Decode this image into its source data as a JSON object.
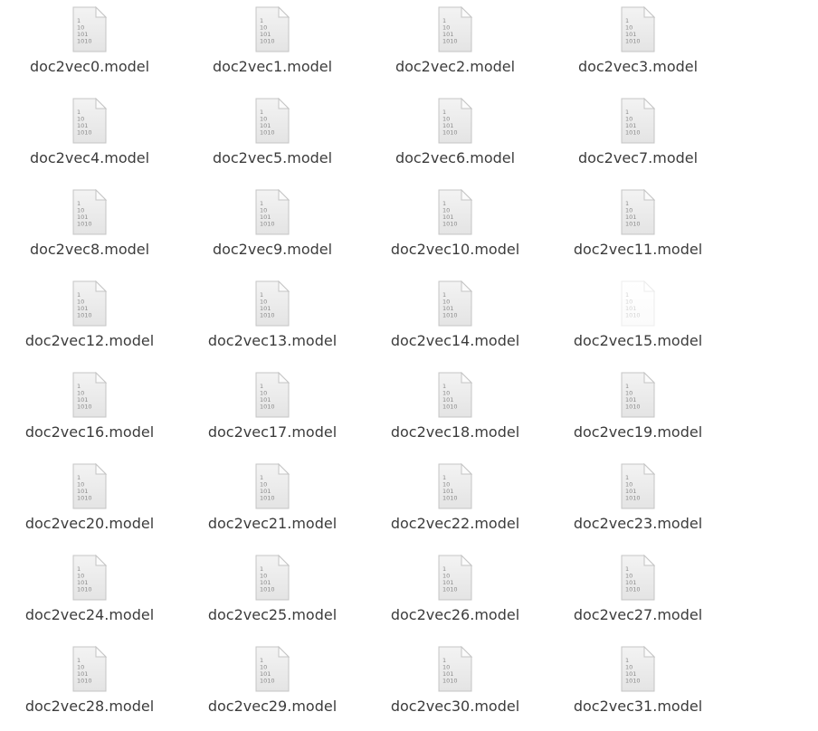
{
  "file_manager": {
    "view": "icon-grid",
    "columns": 4,
    "rows": 8,
    "files": [
      {
        "name": "doc2vec0.model",
        "icon": "binary-file-icon"
      },
      {
        "name": "doc2vec1.model",
        "icon": "binary-file-icon"
      },
      {
        "name": "doc2vec2.model",
        "icon": "binary-file-icon"
      },
      {
        "name": "doc2vec3.model",
        "icon": "binary-file-icon"
      },
      {
        "name": "doc2vec4.model",
        "icon": "binary-file-icon"
      },
      {
        "name": "doc2vec5.model",
        "icon": "binary-file-icon"
      },
      {
        "name": "doc2vec6.model",
        "icon": "binary-file-icon"
      },
      {
        "name": "doc2vec7.model",
        "icon": "binary-file-icon"
      },
      {
        "name": "doc2vec8.model",
        "icon": "binary-file-icon"
      },
      {
        "name": "doc2vec9.model",
        "icon": "binary-file-icon"
      },
      {
        "name": "doc2vec10.model",
        "icon": "binary-file-icon"
      },
      {
        "name": "doc2vec11.model",
        "icon": "binary-file-icon"
      },
      {
        "name": "doc2vec12.model",
        "icon": "binary-file-icon"
      },
      {
        "name": "doc2vec13.model",
        "icon": "binary-file-icon"
      },
      {
        "name": "doc2vec14.model",
        "icon": "binary-file-icon"
      },
      {
        "name": "doc2vec15.model",
        "icon": "binary-file-icon",
        "faded": true
      },
      {
        "name": "doc2vec16.model",
        "icon": "binary-file-icon"
      },
      {
        "name": "doc2vec17.model",
        "icon": "binary-file-icon"
      },
      {
        "name": "doc2vec18.model",
        "icon": "binary-file-icon"
      },
      {
        "name": "doc2vec19.model",
        "icon": "binary-file-icon"
      },
      {
        "name": "doc2vec20.model",
        "icon": "binary-file-icon"
      },
      {
        "name": "doc2vec21.model",
        "icon": "binary-file-icon"
      },
      {
        "name": "doc2vec22.model",
        "icon": "binary-file-icon"
      },
      {
        "name": "doc2vec23.model",
        "icon": "binary-file-icon"
      },
      {
        "name": "doc2vec24.model",
        "icon": "binary-file-icon"
      },
      {
        "name": "doc2vec25.model",
        "icon": "binary-file-icon"
      },
      {
        "name": "doc2vec26.model",
        "icon": "binary-file-icon"
      },
      {
        "name": "doc2vec27.model",
        "icon": "binary-file-icon"
      },
      {
        "name": "doc2vec28.model",
        "icon": "binary-file-icon"
      },
      {
        "name": "doc2vec29.model",
        "icon": "binary-file-icon"
      },
      {
        "name": "doc2vec30.model",
        "icon": "binary-file-icon"
      },
      {
        "name": "doc2vec31.model",
        "icon": "binary-file-icon"
      }
    ]
  },
  "icon_glyph": {
    "lines": [
      "1",
      "10",
      "101",
      "1010"
    ]
  },
  "colors": {
    "label_text": "#3c3c3c",
    "icon_body": "#e4e4e4",
    "icon_border": "#c4c4c4",
    "icon_digits": "#8a8a8a"
  }
}
